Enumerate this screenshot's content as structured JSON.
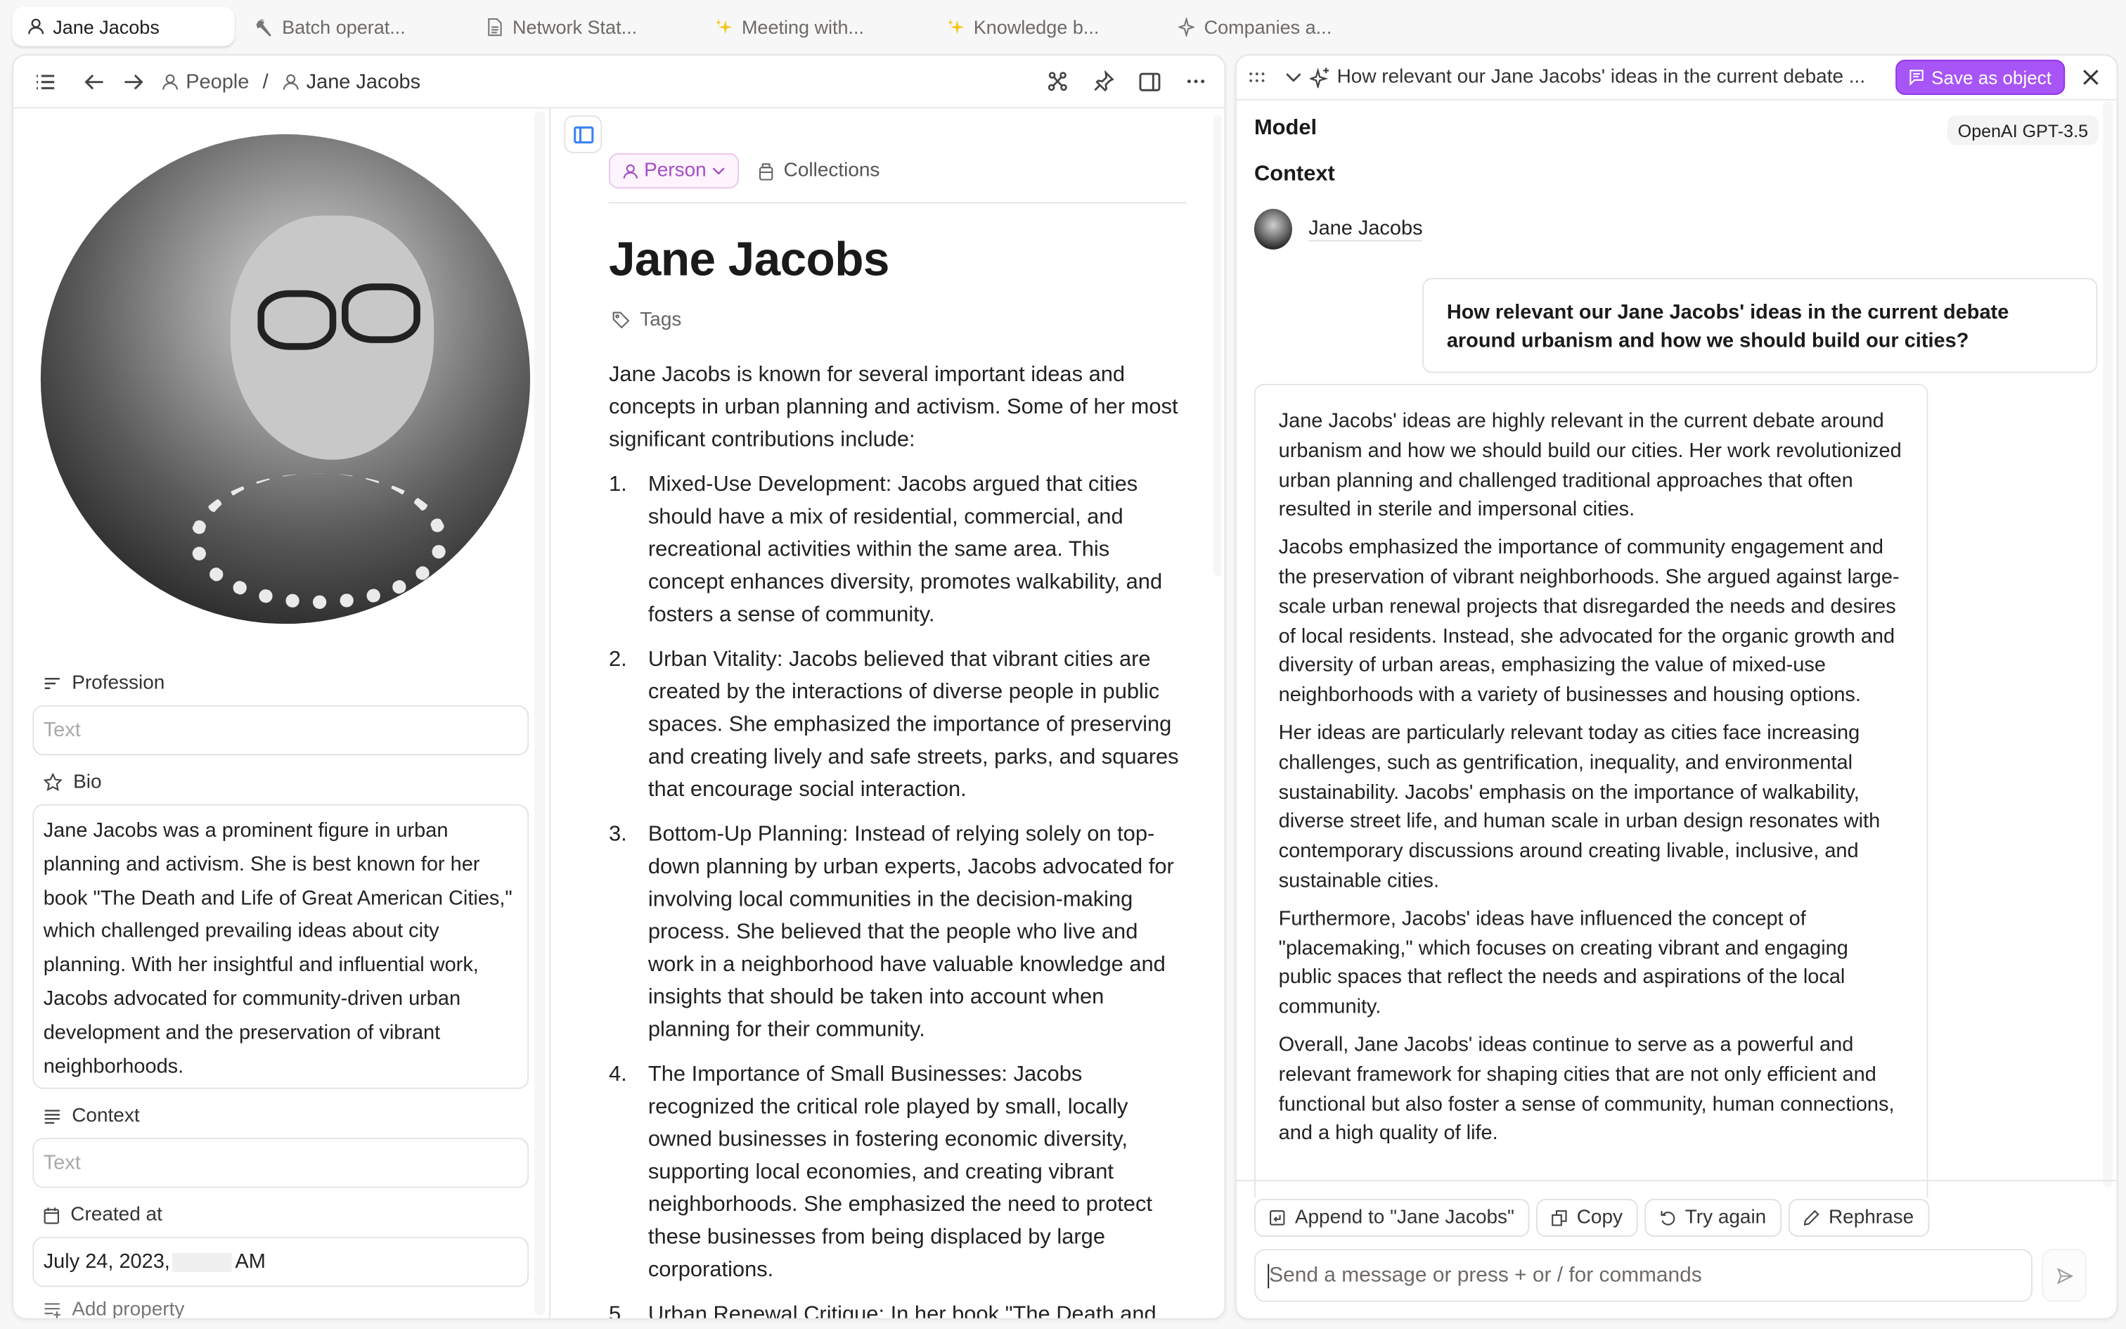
{
  "tabs": [
    {
      "label": "Jane Jacobs",
      "icon": "person-icon",
      "active": true
    },
    {
      "label": "Batch operat...",
      "icon": "hammer-icon",
      "active": false
    },
    {
      "label": "Network Stat...",
      "icon": "document-icon",
      "active": false
    },
    {
      "label": "Meeting with...",
      "icon": "sparkles-icon",
      "active": false
    },
    {
      "label": "Knowledge b...",
      "icon": "sparkles-icon",
      "active": false
    },
    {
      "label": "Companies a...",
      "icon": "sparkle-outline-icon",
      "active": false
    }
  ],
  "object_panel": {
    "breadcrumb": {
      "parent": "People",
      "separator": "/",
      "current": "Jane Jacobs"
    },
    "properties": {
      "profession": {
        "label": "Profession",
        "placeholder": "Text",
        "value": ""
      },
      "bio": {
        "label": "Bio",
        "value": "Jane Jacobs was a prominent figure in urban planning and activism. She is best known for her book \"The Death and Life of Great American Cities,\" which challenged prevailing ideas about city planning. With her insightful and influential work, Jacobs advocated for community-driven urban development and the preservation of vibrant neighborhoods."
      },
      "context": {
        "label": "Context",
        "placeholder": "Text",
        "value": ""
      },
      "created_at": {
        "label": "Created at",
        "date": "July 24, 2023,",
        "suffix": "AM"
      },
      "add_property": "Add property"
    }
  },
  "document": {
    "type_chip": "Person",
    "collections": "Collections",
    "title": "Jane Jacobs",
    "tags": "Tags",
    "intro": "Jane Jacobs is known for several important ideas and concepts in urban planning and activism. Some of her most significant contributions include:",
    "items": [
      {
        "num": "1.",
        "text": "Mixed-Use Development: Jacobs argued that cities should have a mix of residential, commercial, and recreational activities within the same area. This concept enhances diversity, promotes walkability, and fosters a sense of community."
      },
      {
        "num": "2.",
        "text": "Urban Vitality: Jacobs believed that vibrant cities are created by the interactions of diverse people in public spaces. She emphasized the importance of preserving and creating lively and safe streets, parks, and squares that encourage social interaction."
      },
      {
        "num": "3.",
        "text": "Bottom-Up Planning: Instead of relying solely on top-down planning by urban experts, Jacobs advocated for involving local communities in the decision-making process. She believed that the people who live and work in a neighborhood have valuable knowledge and insights that should be taken into account when planning for their community."
      },
      {
        "num": "4.",
        "text": "The Importance of Small Businesses: Jacobs recognized the critical role played by small, locally owned businesses in fostering economic diversity, supporting local economies, and creating vibrant neighborhoods. She emphasized the need to protect these businesses from being displaced by large corporations."
      },
      {
        "num": "5.",
        "text": "Urban Renewal Critique: In her book \"The Death and"
      }
    ]
  },
  "assistant": {
    "title": "How relevant our Jane Jacobs' ideas in the current debate ...",
    "save_button": "Save as object",
    "model_label": "Model",
    "model_value": "OpenAI GPT-3.5",
    "context_label": "Context",
    "context_item": "Jane Jacobs",
    "user_message": "How relevant our Jane Jacobs' ideas in the current debate around urbanism and how we should build our cities?",
    "response": [
      "Jane Jacobs' ideas are highly relevant in the current debate around urbanism and how we should build our cities. Her work revolutionized urban planning and challenged traditional approaches that often resulted in sterile and impersonal cities.",
      "Jacobs emphasized the importance of community engagement and the preservation of vibrant neighborhoods. She argued against large-scale urban renewal projects that disregarded the needs and desires of local residents. Instead, she advocated for the organic growth and diversity of urban areas, emphasizing the value of mixed-use neighborhoods with a variety of businesses and housing options.",
      "Her ideas are particularly relevant today as cities face increasing challenges, such as gentrification, inequality, and environmental sustainability. Jacobs' emphasis on the importance of walkability, diverse street life, and human scale in urban design resonates with contemporary discussions around creating livable, inclusive, and sustainable cities.",
      "Furthermore, Jacobs' ideas have influenced the concept of \"placemaking,\" which focuses on creating vibrant and engaging public spaces that reflect the needs and aspirations of the local community.",
      "Overall, Jane Jacobs' ideas continue to serve as a powerful and relevant framework for shaping cities that are not only efficient and functional but also foster a sense of community, human connections, and a high quality of life."
    ],
    "actions": {
      "append": "Append to \"Jane Jacobs\"",
      "copy": "Copy",
      "try_again": "Try again",
      "rephrase": "Rephrase"
    },
    "input_placeholder": "Send a message or press + or / for commands"
  },
  "colors": {
    "accent_purple": "#a855f7",
    "person_chip": "#a44ec4",
    "sidebar_toggle_blue": "#3b82f6"
  }
}
